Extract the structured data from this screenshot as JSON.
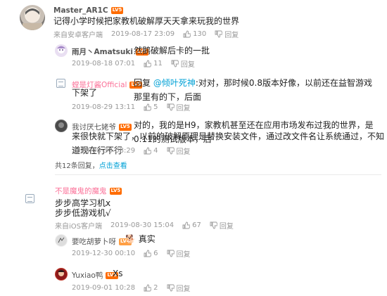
{
  "comment1": {
    "user": "Master_AR1C",
    "level": "LV5",
    "text": "记得小学时候把家教机破解厚天天拿来玩我的世界",
    "client": "来自安卓客户端",
    "time": "2019-08-17 23:09",
    "likes": "130",
    "reply_label": "回复"
  },
  "replies": [
    {
      "user": "雨月丶Amatsuki",
      "level": "LV5",
      "text": "然鹅破解后卡的一批",
      "time": "2019-08-18 07:01",
      "likes": "11",
      "reply_label": "回复"
    },
    {
      "user": "螳是灯酱Official",
      "level": "LV5",
      "prefix": "回复",
      "mention": "@倾叶死神",
      "text_line1": ":对对，那时候0.8版本好像，以前还在益智游戏那里有的下，后面",
      "text_line2": "下架了",
      "time": "2019-08-29 13:11",
      "likes": "5",
      "reply_label": "回复"
    },
    {
      "user": "我讨厌七姥爷",
      "level": "LV5",
      "text_line1": "对的，我的是H9，家教机甚至还在应用市场发布过我的世界，是0.11的测试版本，后",
      "text_line2": "来很快就下架了，以前的破解原理是替换安装文件，通过改文件名让系统通过，不知道现在行不行",
      "time": "2019-08-30 08:29",
      "likes": "4",
      "reply_label": "回复"
    }
  ],
  "replies_summary": {
    "total_prefix": "共12条回复，",
    "view_link": "点击查看"
  },
  "comment2": {
    "user": "不是魔鬼的魔鬼",
    "level": "LV5",
    "line1": "步步高学习机x",
    "line2": "步步低游戏机√",
    "client": "来自iOS客户端",
    "time": "2019-08-30 15:04",
    "likes": "67",
    "reply_label": "回复"
  },
  "replies2": [
    {
      "user": "要吃胡萝卜呀",
      "level": "LV4",
      "emoji": "🐕",
      "text": "真实",
      "time": "2019-12-30 00:10",
      "likes": "6",
      "reply_label": "回复"
    },
    {
      "user": "Yuxiao鸭",
      "level": "LV5",
      "text": "Xs",
      "time": "2019-09-01 10:28",
      "likes": "2",
      "reply_label": "回复"
    }
  ],
  "colors": {
    "link": "#00a1d6",
    "vip_name": "#fb7299",
    "meta": "#999999",
    "level_badge": "#ff6c00"
  }
}
